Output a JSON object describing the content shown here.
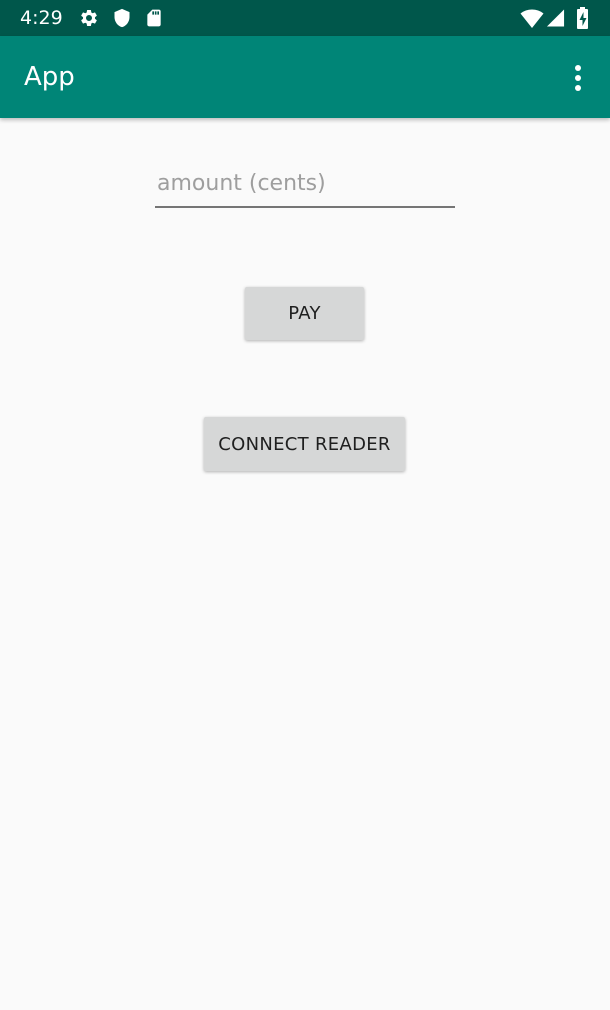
{
  "status_bar": {
    "time": "4:29",
    "icons": [
      "gear-icon",
      "shield-icon",
      "sd-card-icon",
      "wifi-icon",
      "signal-icon",
      "battery-charging-icon"
    ],
    "background": "#00574b"
  },
  "app_bar": {
    "title": "App",
    "menu_icon": "more-vert-icon",
    "background": "#008577"
  },
  "form": {
    "amount_placeholder": "amount (cents)",
    "amount_value": ""
  },
  "buttons": {
    "pay_label": "PAY",
    "connect_label": "CONNECT READER",
    "background": "#d6d7d7"
  }
}
